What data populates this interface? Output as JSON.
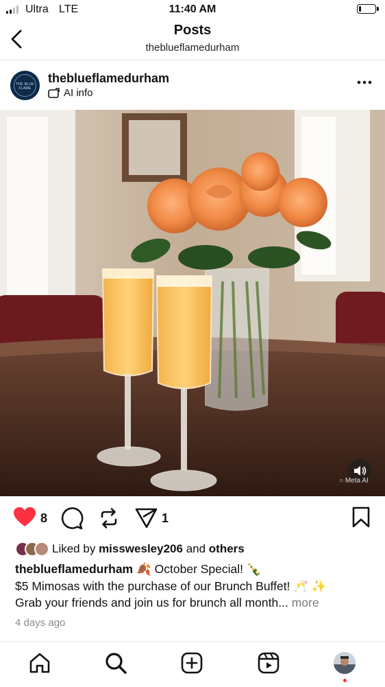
{
  "status_bar": {
    "carrier": "Ultra",
    "network": "LTE",
    "time": "11:40 AM",
    "battery_level": 0.12
  },
  "header": {
    "title": "Posts",
    "subtitle": "theblueflamedurham"
  },
  "post": {
    "username": "theblueflamedurham",
    "ai_info_label": "AI info",
    "avatar_text": "THE BLUE FLAME",
    "image_watermark": "Meta AI",
    "likes_count": "8",
    "shares_count": "1",
    "liked_by": {
      "prefix": "Liked by",
      "user": "misswesley206",
      "middle": "and",
      "suffix": "others"
    },
    "caption": {
      "username": "theblueflamedurham",
      "line1": "🍂 October Special! 🍾",
      "line2": "$5 Mimosas with the purchase of our Brunch Buffet! 🥂 ✨",
      "line3": "Grab your friends and join us for brunch all month...",
      "more_label": "more"
    },
    "time_ago": "4 days ago"
  },
  "icons": {
    "back": "back-arrow-icon",
    "more": "more-dots-icon",
    "like": "heart-icon",
    "comment": "comment-icon",
    "repost": "repost-icon",
    "share": "send-icon",
    "save": "bookmark-icon",
    "home": "home-icon",
    "search": "search-icon",
    "create": "plus-square-icon",
    "reels": "reels-icon"
  },
  "colors": {
    "like_red": "#ff3040",
    "text": "#111111",
    "muted": "#8a8a8a"
  }
}
